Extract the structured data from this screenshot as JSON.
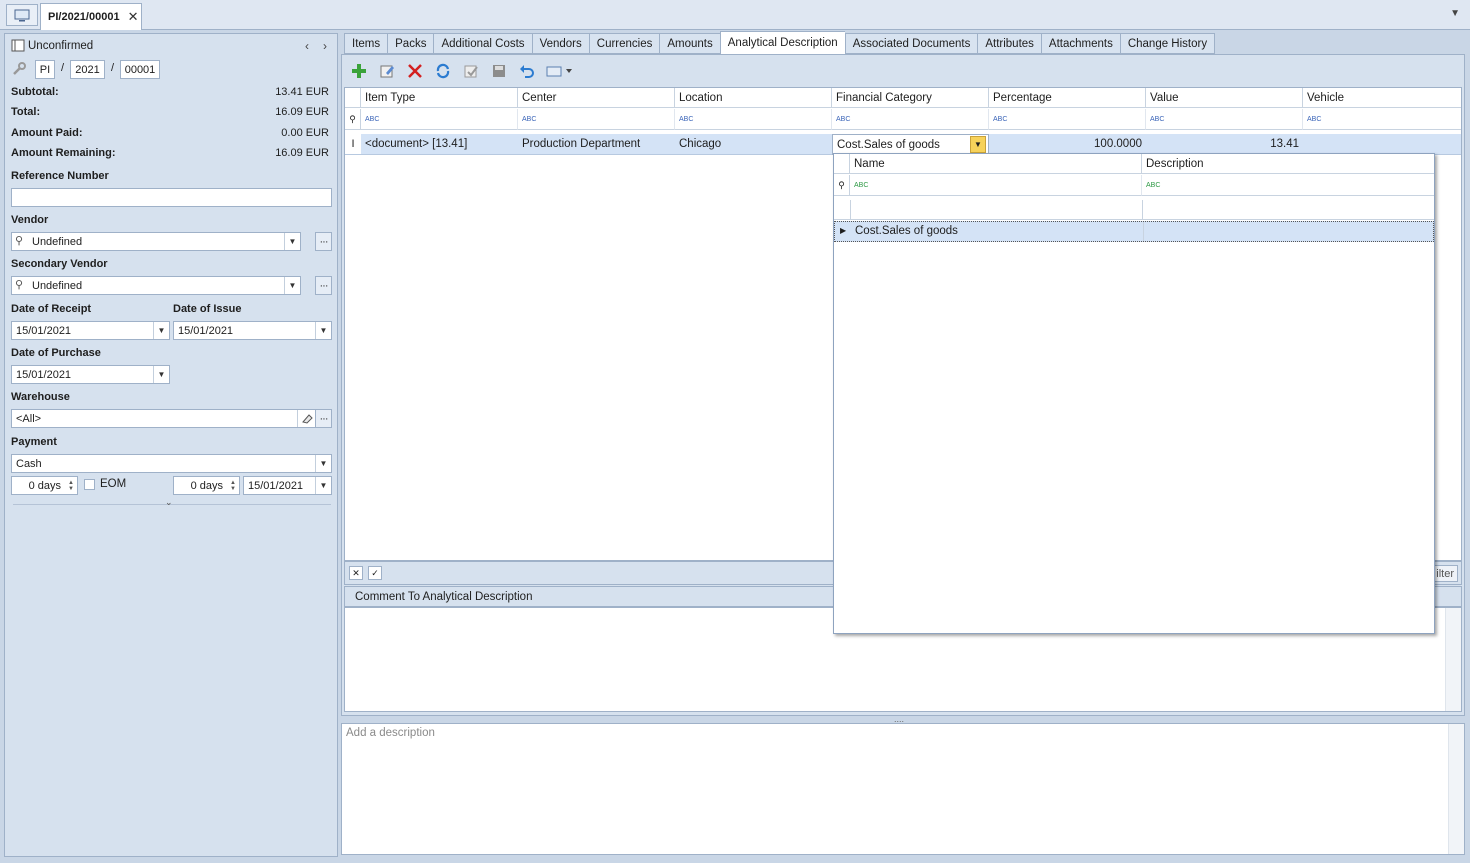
{
  "top_tab": {
    "title": "PI/2021/00001"
  },
  "header": {
    "status": "Unconfirmed",
    "series": "PI",
    "year": "2021",
    "number": "00001"
  },
  "summary": [
    {
      "label": "Subtotal:",
      "value": "13.41 EUR"
    },
    {
      "label": "Total:",
      "value": "16.09 EUR"
    },
    {
      "label": "Amount Paid:",
      "value": "0.00 EUR"
    },
    {
      "label": "Amount Remaining:",
      "value": "16.09 EUR"
    }
  ],
  "form": {
    "reference_label": "Reference Number",
    "reference_value": "",
    "vendor_label": "Vendor",
    "vendor_value": "Undefined",
    "secondary_vendor_label": "Secondary Vendor",
    "secondary_vendor_value": "Undefined",
    "date_receipt_label": "Date of Receipt",
    "date_receipt_value": "15/01/2021",
    "date_issue_label": "Date of Issue",
    "date_issue_value": "15/01/2021",
    "date_purchase_label": "Date of Purchase",
    "date_purchase_value": "15/01/2021",
    "warehouse_label": "Warehouse",
    "warehouse_value": "<All>",
    "payment_label": "Payment",
    "payment_value": "Cash",
    "days1": "0 days",
    "eom_label": "EOM",
    "days2": "0 days",
    "due_date": "15/01/2021"
  },
  "tabs": [
    "Items",
    "Packs",
    "Additional Costs",
    "Vendors",
    "Currencies",
    "Amounts",
    "Analytical Description",
    "Associated Documents",
    "Attributes",
    "Attachments",
    "Change History"
  ],
  "active_tab": "Analytical Description",
  "grid": {
    "columns": [
      "Item Type",
      "Center",
      "Location",
      "Financial Category",
      "Percentage",
      "Value",
      "Vehicle"
    ],
    "filter_glyph": "ABC",
    "row": {
      "item_type": "<document> [13.41]",
      "center": "Production Department",
      "location": "Chicago",
      "financial_category": "Cost.Sales of goods",
      "percentage": "100.0000",
      "value": "13.41",
      "vehicle": ""
    }
  },
  "footer_right": "ilter",
  "popup": {
    "columns": [
      "Name",
      "Description"
    ],
    "filter_glyph": "ABC",
    "rows": [
      {
        "name": "Cost.Sales of goods",
        "description": ""
      }
    ]
  },
  "comment_label": "Comment To Analytical Description",
  "description_placeholder": "Add a description",
  "colors": {
    "accent": "#d4e3f6",
    "panel": "#d6e1ee",
    "border": "#9fb1c8",
    "dropdown_active": "#f7d25a"
  }
}
